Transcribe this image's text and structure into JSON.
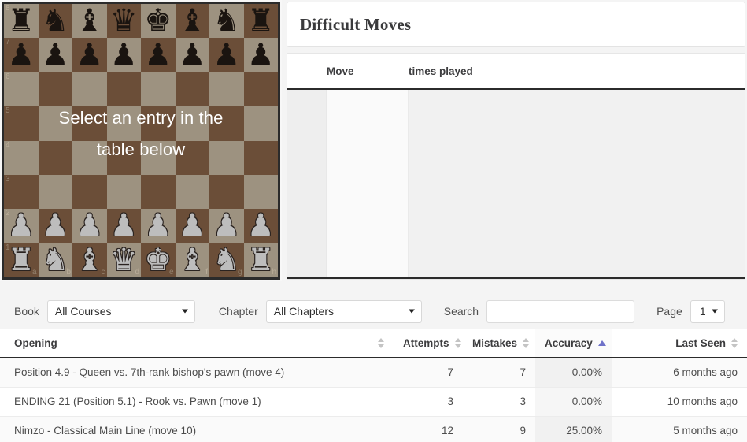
{
  "board": {
    "overlay_text_line1": "Select an entry in the",
    "overlay_text_line2": "table below",
    "light_square_color": "#9d9280",
    "dark_square_color": "#6b4e38",
    "files": [
      "a",
      "b",
      "c",
      "d",
      "e",
      "f",
      "g",
      "h"
    ],
    "ranks": [
      "8",
      "7",
      "6",
      "5",
      "4",
      "3",
      "2",
      "1"
    ],
    "position": "standard starting position",
    "rows": [
      [
        {
          "p": "♜",
          "c": "black"
        },
        {
          "p": "♞",
          "c": "black"
        },
        {
          "p": "♝",
          "c": "black"
        },
        {
          "p": "♛",
          "c": "black"
        },
        {
          "p": "♚",
          "c": "black"
        },
        {
          "p": "♝",
          "c": "black"
        },
        {
          "p": "♞",
          "c": "black"
        },
        {
          "p": "♜",
          "c": "black"
        }
      ],
      [
        {
          "p": "♟",
          "c": "black"
        },
        {
          "p": "♟",
          "c": "black"
        },
        {
          "p": "♟",
          "c": "black"
        },
        {
          "p": "♟",
          "c": "black"
        },
        {
          "p": "♟",
          "c": "black"
        },
        {
          "p": "♟",
          "c": "black"
        },
        {
          "p": "♟",
          "c": "black"
        },
        {
          "p": "♟",
          "c": "black"
        }
      ],
      [
        {
          "p": "",
          "c": ""
        },
        {
          "p": "",
          "c": ""
        },
        {
          "p": "",
          "c": ""
        },
        {
          "p": "",
          "c": ""
        },
        {
          "p": "",
          "c": ""
        },
        {
          "p": "",
          "c": ""
        },
        {
          "p": "",
          "c": ""
        },
        {
          "p": "",
          "c": ""
        }
      ],
      [
        {
          "p": "",
          "c": ""
        },
        {
          "p": "",
          "c": ""
        },
        {
          "p": "",
          "c": ""
        },
        {
          "p": "",
          "c": ""
        },
        {
          "p": "",
          "c": ""
        },
        {
          "p": "",
          "c": ""
        },
        {
          "p": "",
          "c": ""
        },
        {
          "p": "",
          "c": ""
        }
      ],
      [
        {
          "p": "",
          "c": ""
        },
        {
          "p": "",
          "c": ""
        },
        {
          "p": "",
          "c": ""
        },
        {
          "p": "",
          "c": ""
        },
        {
          "p": "",
          "c": ""
        },
        {
          "p": "",
          "c": ""
        },
        {
          "p": "",
          "c": ""
        },
        {
          "p": "",
          "c": ""
        }
      ],
      [
        {
          "p": "",
          "c": ""
        },
        {
          "p": "",
          "c": ""
        },
        {
          "p": "",
          "c": ""
        },
        {
          "p": "",
          "c": ""
        },
        {
          "p": "",
          "c": ""
        },
        {
          "p": "",
          "c": ""
        },
        {
          "p": "",
          "c": ""
        },
        {
          "p": "",
          "c": ""
        }
      ],
      [
        {
          "p": "♟",
          "c": "white"
        },
        {
          "p": "♟",
          "c": "white"
        },
        {
          "p": "♟",
          "c": "white"
        },
        {
          "p": "♟",
          "c": "white"
        },
        {
          "p": "♟",
          "c": "white"
        },
        {
          "p": "♟",
          "c": "white"
        },
        {
          "p": "♟",
          "c": "white"
        },
        {
          "p": "♟",
          "c": "white"
        }
      ],
      [
        {
          "p": "♜",
          "c": "white"
        },
        {
          "p": "♞",
          "c": "white"
        },
        {
          "p": "♝",
          "c": "white"
        },
        {
          "p": "♛",
          "c": "white"
        },
        {
          "p": "♚",
          "c": "white"
        },
        {
          "p": "♝",
          "c": "white"
        },
        {
          "p": "♞",
          "c": "white"
        },
        {
          "p": "♜",
          "c": "white"
        }
      ]
    ]
  },
  "difficult_moves": {
    "title": "Difficult Moves",
    "columns": [
      "Move",
      "times played"
    ],
    "rows": []
  },
  "filters": {
    "book_label": "Book",
    "book_value": "All Courses",
    "chapter_label": "Chapter",
    "chapter_value": "All Chapters",
    "search_label": "Search",
    "search_value": "",
    "search_placeholder": "",
    "page_label": "Page",
    "page_value": "1"
  },
  "table": {
    "columns": [
      {
        "label": "Opening",
        "sort": "none"
      },
      {
        "label": "Attempts",
        "sort": "none"
      },
      {
        "label": "Mistakes",
        "sort": "none"
      },
      {
        "label": "Accuracy",
        "sort": "asc"
      },
      {
        "label": "Last Seen",
        "sort": "none"
      }
    ],
    "rows": [
      {
        "opening": "Position 4.9 - Queen vs. 7th-rank bishop's pawn (move 4)",
        "attempts": "7",
        "mistakes": "7",
        "accuracy": "0.00%",
        "last_seen": "6 months ago"
      },
      {
        "opening": "ENDING 21 (Position 5.1) - Rook vs. Pawn (move 1)",
        "attempts": "3",
        "mistakes": "3",
        "accuracy": "0.00%",
        "last_seen": "10 months ago"
      },
      {
        "opening": "Nimzo - Classical Main Line (move 10)",
        "attempts": "12",
        "mistakes": "9",
        "accuracy": "25.00%",
        "last_seen": "5 months ago"
      }
    ]
  },
  "colors": {
    "sort_active": "#6f72c9",
    "sort_inactive": "#c4c4c4",
    "page_background": "#f4f4f4"
  }
}
